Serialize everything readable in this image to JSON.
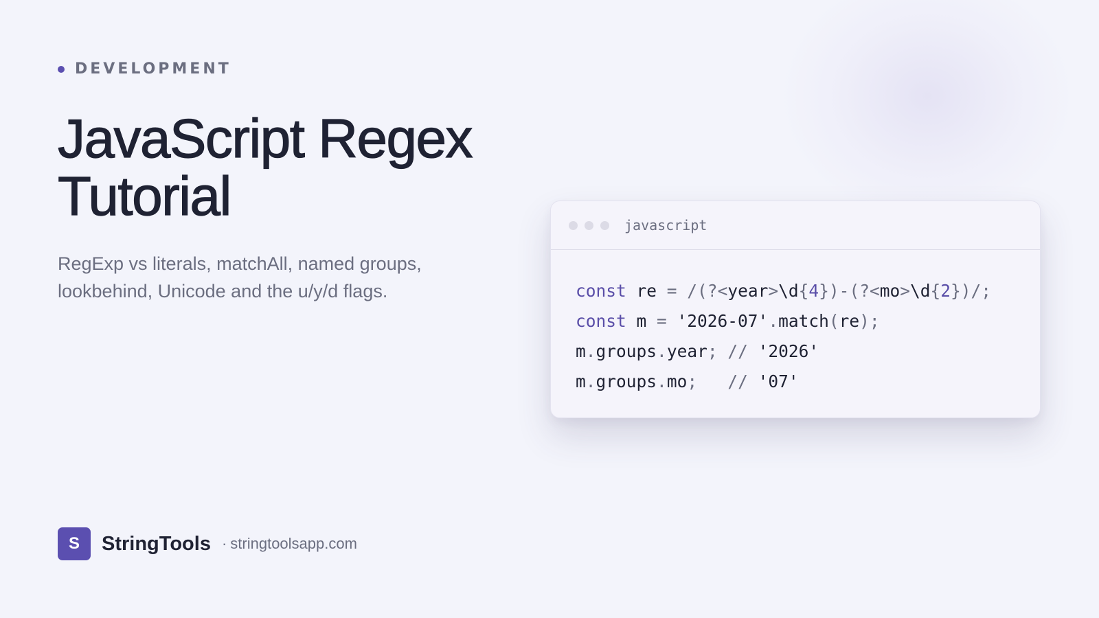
{
  "kicker": {
    "label": "DEVELOPMENT"
  },
  "title": {
    "lines": [
      "JavaScript Regex",
      "Tutorial"
    ]
  },
  "subtitle": {
    "lines": [
      "RegExp vs literals, matchAll, named groups,",
      "lookbehind, Unicode and the u/y/d flags."
    ]
  },
  "code_window": {
    "language": "javascript",
    "lines": [
      [
        {
          "t": "const",
          "k": "kw"
        },
        {
          "t": " re ",
          "k": "plain"
        },
        {
          "t": "=",
          "k": "punc"
        },
        {
          "t": " /(?",
          "k": "punc"
        },
        {
          "t": "<",
          "k": "punc"
        },
        {
          "t": "year",
          "k": "plain"
        },
        {
          "t": ">",
          "k": "punc"
        },
        {
          "t": "\\d",
          "k": "plain"
        },
        {
          "t": "{",
          "k": "punc"
        },
        {
          "t": "4",
          "k": "num"
        },
        {
          "t": "})",
          "k": "punc"
        },
        {
          "t": "-",
          "k": "punc"
        },
        {
          "t": "(?",
          "k": "punc"
        },
        {
          "t": "<",
          "k": "punc"
        },
        {
          "t": "mo",
          "k": "plain"
        },
        {
          "t": ">",
          "k": "punc"
        },
        {
          "t": "\\d",
          "k": "plain"
        },
        {
          "t": "{",
          "k": "punc"
        },
        {
          "t": "2",
          "k": "num"
        },
        {
          "t": "})/;",
          "k": "punc"
        }
      ],
      [
        {
          "t": "const",
          "k": "kw"
        },
        {
          "t": " m ",
          "k": "plain"
        },
        {
          "t": "=",
          "k": "punc"
        },
        {
          "t": " '2026-07'",
          "k": "plain"
        },
        {
          "t": ".",
          "k": "punc"
        },
        {
          "t": "match",
          "k": "plain"
        },
        {
          "t": "(",
          "k": "punc"
        },
        {
          "t": "re",
          "k": "plain"
        },
        {
          "t": ");",
          "k": "punc"
        }
      ],
      [
        {
          "t": "m",
          "k": "plain"
        },
        {
          "t": ".",
          "k": "punc"
        },
        {
          "t": "groups",
          "k": "plain"
        },
        {
          "t": ".",
          "k": "punc"
        },
        {
          "t": "year",
          "k": "plain"
        },
        {
          "t": ";",
          "k": "punc"
        },
        {
          "t": " // ",
          "k": "comment"
        },
        {
          "t": "'2026'",
          "k": "plain"
        }
      ],
      [
        {
          "t": "m",
          "k": "plain"
        },
        {
          "t": ".",
          "k": "punc"
        },
        {
          "t": "groups",
          "k": "plain"
        },
        {
          "t": ".",
          "k": "punc"
        },
        {
          "t": "mo",
          "k": "plain"
        },
        {
          "t": ";",
          "k": "punc"
        },
        {
          "t": "   // ",
          "k": "comment"
        },
        {
          "t": "'07'",
          "k": "plain"
        }
      ]
    ]
  },
  "footer": {
    "logo_letter": "S",
    "brand": "StringTools",
    "separator": "·",
    "url": "stringtoolsapp.com"
  },
  "colors": {
    "accent": "#5b4fb0",
    "background": "#f3f4fb",
    "text": "#1f2233",
    "muted": "#6b6e80"
  }
}
